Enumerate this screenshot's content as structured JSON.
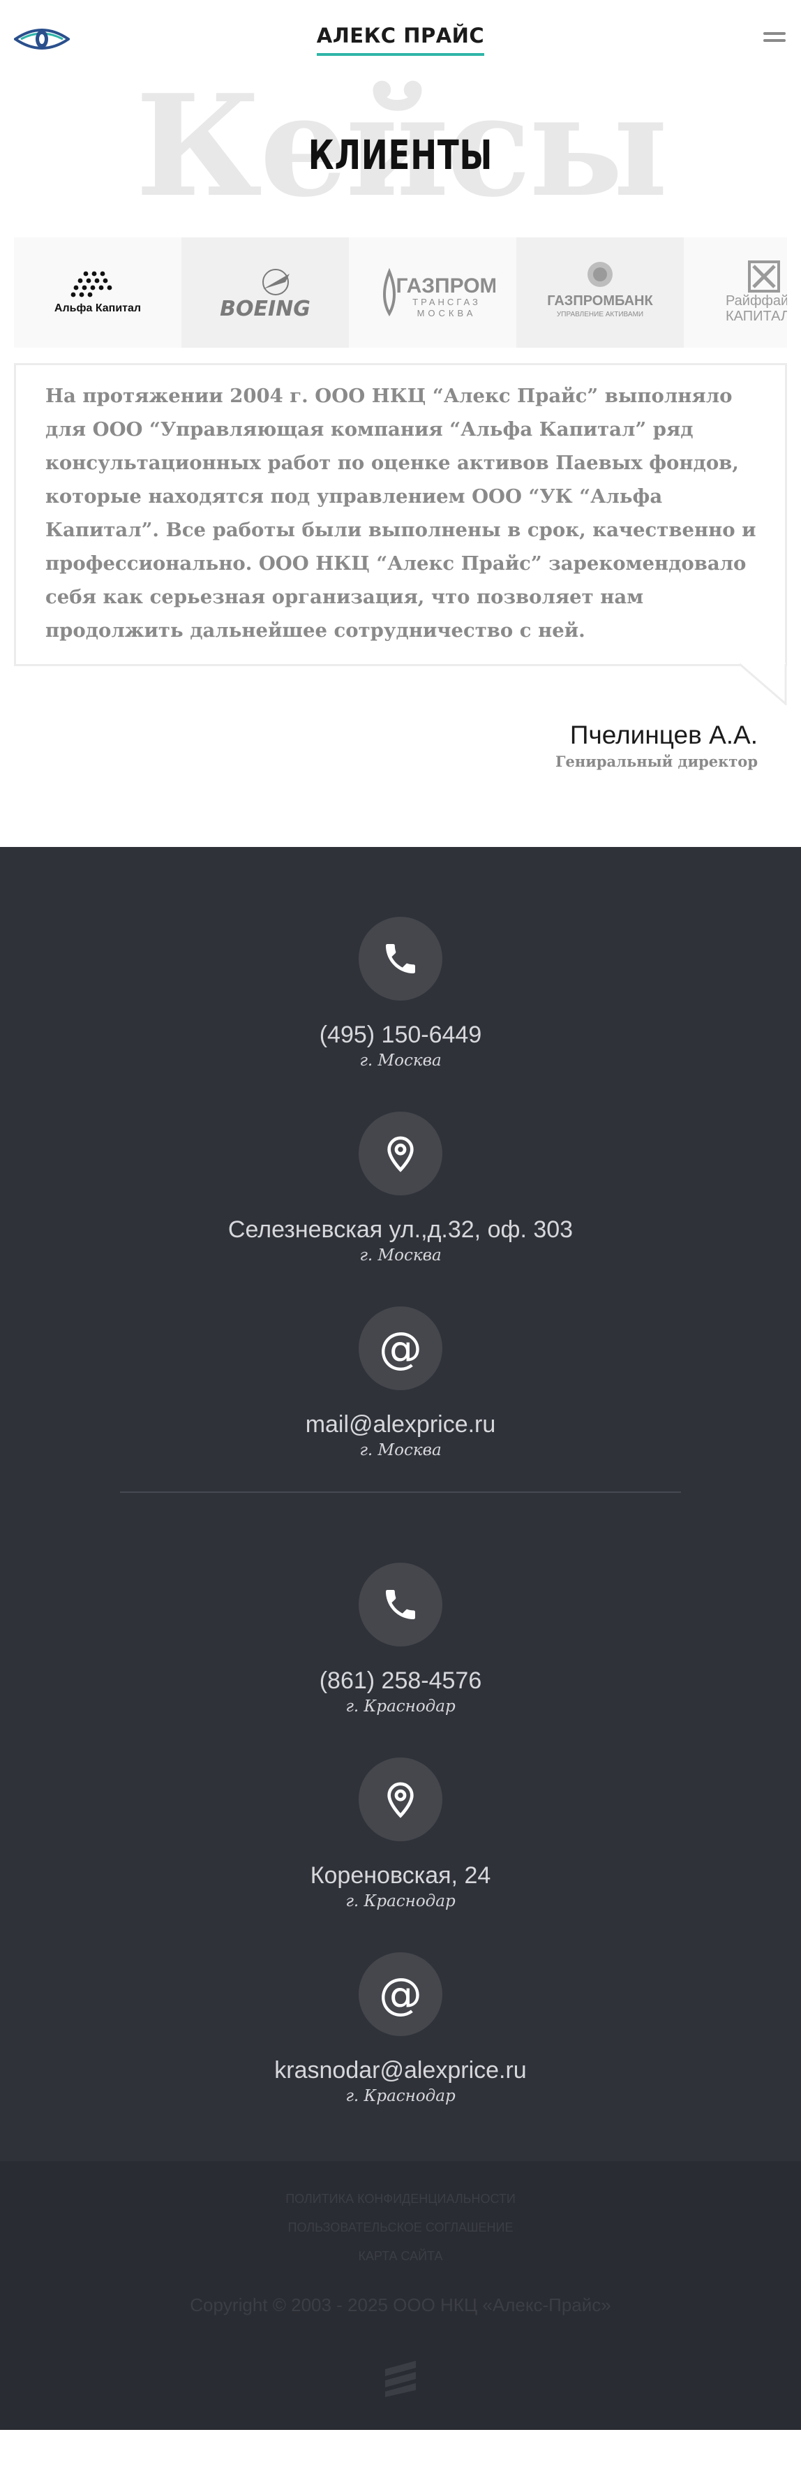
{
  "header": {
    "brand": "АЛЕКС ПРАЙС",
    "logo_icon": "eye-logo-icon",
    "menu_icon": "hamburger-menu-icon",
    "accent_color": "#2fb5a8"
  },
  "section": {
    "ghost_title": "Кейсы",
    "title": "КЛИЕНТЫ"
  },
  "clients": [
    {
      "name": "Альфа Капитал"
    },
    {
      "name": "BOEING"
    },
    {
      "name": "ГАЗПРОМ",
      "sub": "ТРАНСГАЗ",
      "sub2": "МОСКВА"
    },
    {
      "name": "ГАЗПРОМБАНК",
      "sub": "УПРАВЛЕНИЕ АКТИВАМИ"
    },
    {
      "name": "Райффай",
      "sub": "КАПИТАЛ"
    }
  ],
  "testimonial": {
    "text": "На протяжении 2004 г. ООО НКЦ “Алекс Прайс” выполняло для ООО “Управляющая компания “Альфа Капитал” ряд консультационных работ по оценке активов Паевых фондов, которые находятся под управлением ООО “УК “Альфа Капитал”. Все работы были выполнены в срок, качественно и профессионально. ООО НКЦ “Алекс Прайс” зарекомендовало себя как серьезная организация, что позволяет нам продолжить дальнейшее сотрудничество с ней.",
    "author": "Пчелинцев А.А.",
    "role": "Гениральный директор"
  },
  "contacts": {
    "moscow": {
      "phone": {
        "value": "(495) 150-6449",
        "city": "г. Москва",
        "icon": "phone-icon"
      },
      "address": {
        "value": "Селезневская ул.,д.32, оф. 303",
        "city": "г. Москва",
        "icon": "map-pin-icon"
      },
      "email": {
        "value": "mail@alexprice.ru",
        "city": "г. Москва",
        "icon": "at-icon"
      }
    },
    "krasnodar": {
      "phone": {
        "value": "(861) 258-4576",
        "city": "г. Краснодар",
        "icon": "phone-icon"
      },
      "address": {
        "value": "Кореновская, 24",
        "city": "г. Краснодар",
        "icon": "map-pin-icon"
      },
      "email": {
        "value": "krasnodar@alexprice.ru",
        "city": "г. Краснодар",
        "icon": "at-icon"
      }
    }
  },
  "footer": {
    "links": [
      "ПОЛИТИКА КОНФИДЕНЦИАЛЬНОСТИ",
      "ПОЛЬЗОВАТЕЛЬСКОЕ СОГЛАШЕНИЕ",
      "КАРТА САЙТА"
    ],
    "copyright": "Copyright © 2003 - 2025 ООО НКЦ «Алекс-Прайс»",
    "mark_icon": "studio-logo-icon"
  }
}
